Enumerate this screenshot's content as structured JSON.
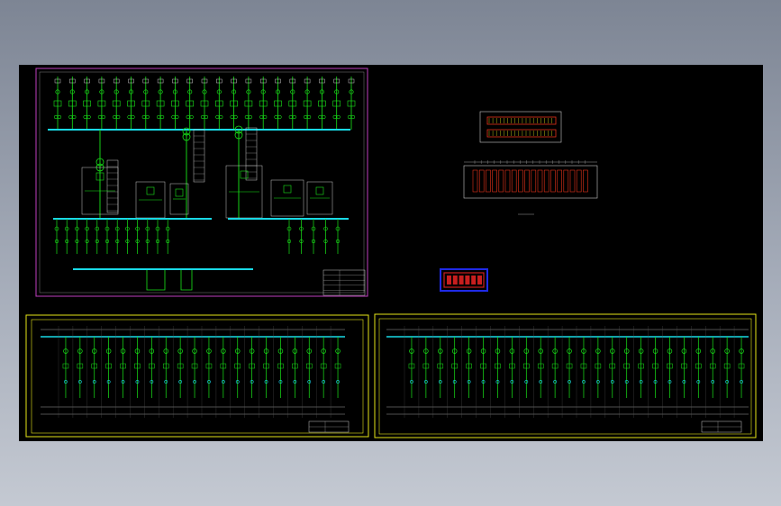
{
  "app": {
    "background_colors": [
      "#7d8594",
      "#c4c9d2"
    ],
    "viewport_color": "#000000"
  },
  "sheets": {
    "main": {
      "frame_color": "#c040c0",
      "feeder_color": "#19e619",
      "busbar_color": "#19d9e6",
      "title_block_color": "#c8c8c8",
      "top_feeders": 21,
      "bottom_feeders": 20
    },
    "switchgear_left": {
      "frame_color": "#e6e619",
      "column_count": 20
    },
    "switchgear_right": {
      "frame_color": "#e6e619",
      "column_count": 24
    },
    "floor_plan": {
      "outline_color": "#c8c8c8",
      "accent_color": "#e63219",
      "panel_count": 18
    },
    "stamp": {
      "frame_color": "#1f2ae6",
      "fill_color": "#c81e1e"
    }
  }
}
